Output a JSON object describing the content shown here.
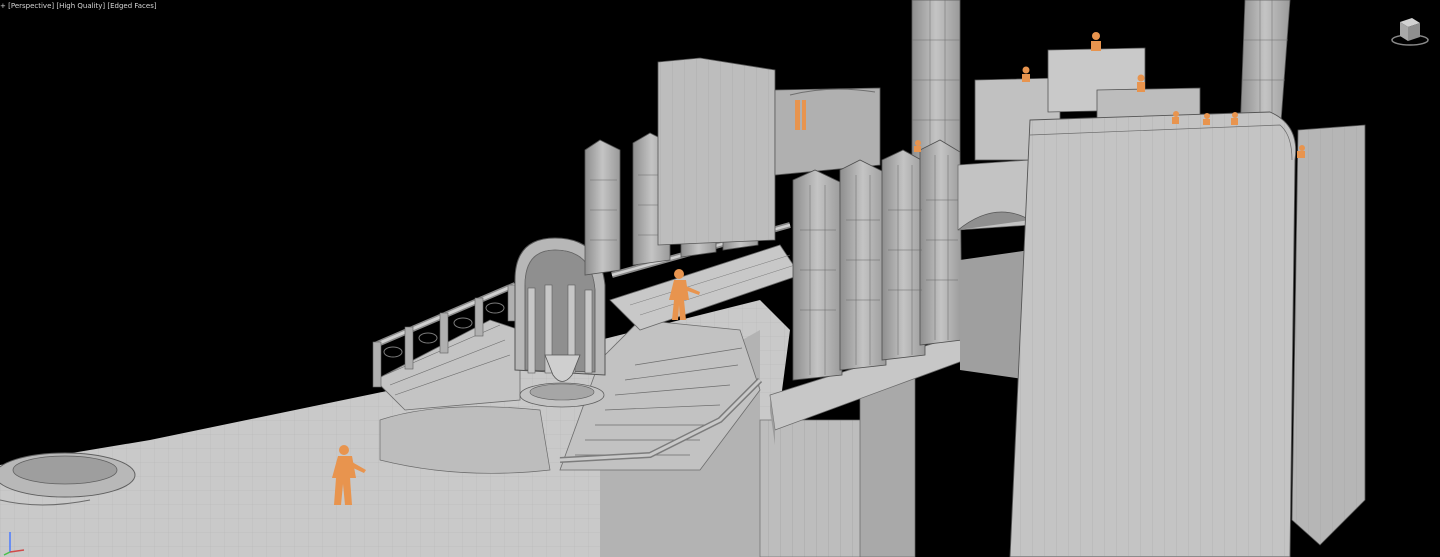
{
  "viewport": {
    "label_parts": [
      "+",
      "Perspective",
      "High Quality",
      "Edged Faces"
    ],
    "background": "#000000"
  },
  "colors": {
    "geometry": "#b9b9b9",
    "geometry_light": "#cfcfcf",
    "geometry_dark": "#8d8d8d",
    "wire": "#5a5a5a",
    "figure": "#e8944e"
  },
  "icons": {
    "viewcube": "viewcube-icon",
    "axis": "axis-tripod-icon"
  }
}
